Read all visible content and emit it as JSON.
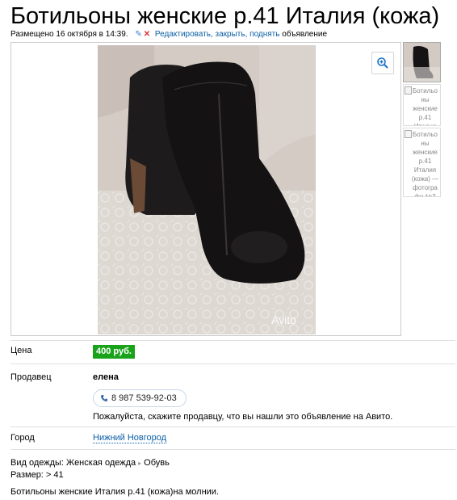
{
  "listing": {
    "title": "Ботильоны женские р.41 Италия (кожа)",
    "posted": "Размещено 16 октября в 14:39.",
    "edit_link": "Редактировать, закрыть, поднять",
    "edit_suffix": "объявление"
  },
  "gallery": {
    "main_photo_icon": "photo-image",
    "zoom_icon": "zoom-plus-icon",
    "thumbnails": [
      {
        "type": "image"
      },
      {
        "alt": "Ботильоны женские р.41 Италия"
      },
      {
        "alt": "Ботильоны женские р.41 Италия (кожа) — фотографи №3"
      }
    ]
  },
  "details": {
    "price_label": "Цена",
    "price_value": "400 руб.",
    "seller_label": "Продавец",
    "seller_name": "елена",
    "phone": "8 987 539-92-03",
    "phone_hint": "Пожалуйста, скажите продавцу, что вы нашли это объявление на Авито.",
    "city_label": "Город",
    "city_value": "Нижний Новгород"
  },
  "params": {
    "category_label": "Вид одежды:",
    "category_value": "Женская одежда",
    "category_sub": "Обувь",
    "size_text": "Размер: > 41"
  },
  "description": "Ботильоны женские Италия р.41 (кожа)на молнии.",
  "colors": {
    "price_bg": "#1aa31a",
    "link": "#0b5fa5"
  }
}
